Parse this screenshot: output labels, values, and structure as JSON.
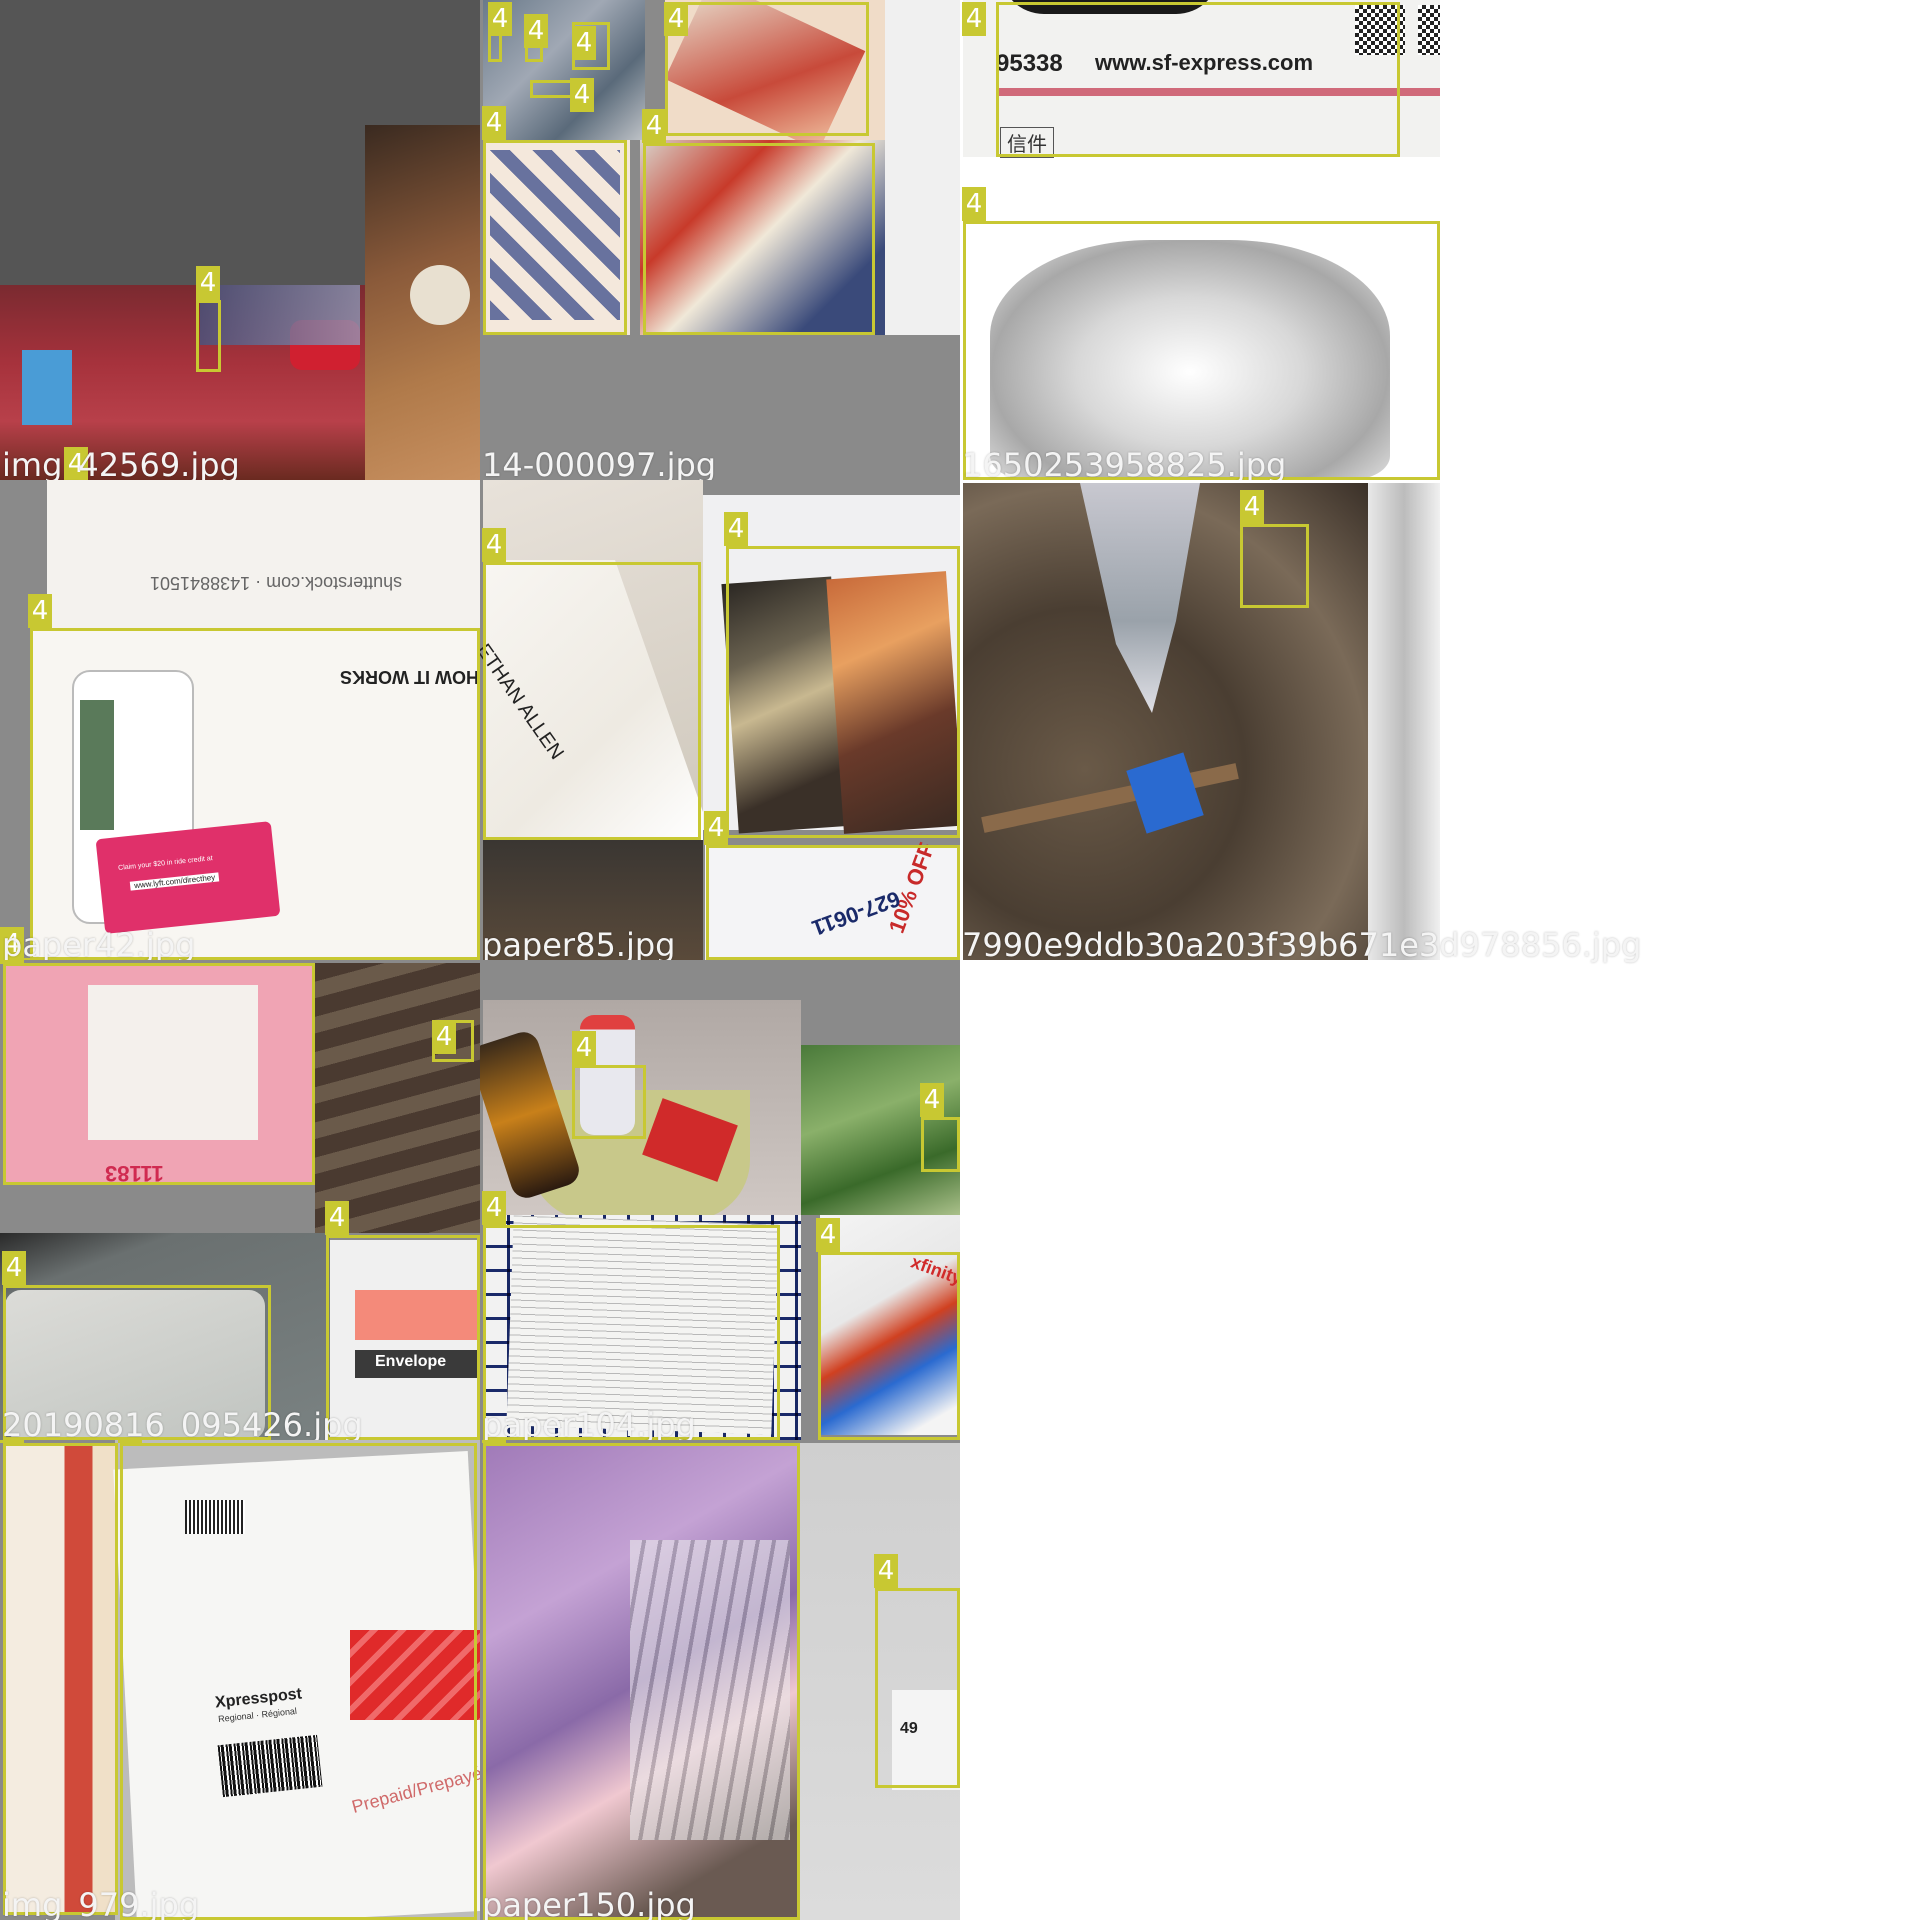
{
  "colors": {
    "box": "#c8c832",
    "label_text": "#ffffff",
    "filename_text": "#f4f4f4",
    "gray_background": "#8a8a8a",
    "dark_background": "#555555"
  },
  "tiles": [
    {
      "filename": "img_42569.jpg",
      "box_labels": [
        "4",
        "4"
      ]
    },
    {
      "filename": "14-000097.jpg",
      "box_labels": [
        "4",
        "4",
        "4",
        "4",
        "4",
        "4",
        "4",
        "4"
      ]
    },
    {
      "filename": "1650253958825.jpg",
      "box_labels": [
        "4",
        "4"
      ],
      "texts": {
        "phone": "95338",
        "url": "www.sf-express.com",
        "stamp": "信件"
      }
    },
    {
      "filename": "paper42.jpg",
      "box_labels": [
        "4",
        "4"
      ],
      "texts": {
        "heading": "HOW IT WORKS",
        "watermark": "shutterstock.com · 1438841501",
        "promo": "Claim your $20 in ride credit at",
        "link": "www.lyft.com/directhey"
      }
    },
    {
      "filename": "paper85.jpg",
      "box_labels": [
        "4",
        "4",
        "4"
      ],
      "texts": {
        "brand": "ETHAN ALLEN",
        "phone": "627-0611",
        "discount": "10% OFF"
      }
    },
    {
      "filename": "7990e9ddb30a203f39b671e3d978856.jpg",
      "box_labels": [
        "4"
      ]
    },
    {
      "filename": "20190816_095426.jpg",
      "box_labels": [
        "4",
        "4",
        "4",
        "4"
      ],
      "texts": {
        "envelope": "Envelope",
        "code": "11183"
      }
    },
    {
      "filename": "paper104.jpg",
      "box_labels": [
        "4",
        "4",
        "4",
        "4"
      ],
      "texts": {
        "brand": "xfinity"
      }
    },
    {
      "filename": "img_979.jpg",
      "box_labels": [
        "4",
        "4"
      ],
      "texts": {
        "brand": "Xpresspost",
        "sub": "Regional · Régional",
        "prepaid": "Prepaid/Prepayé"
      }
    },
    {
      "filename": "paper150.jpg",
      "box_labels": [
        "4",
        "4"
      ],
      "texts": {
        "price": "49"
      }
    }
  ]
}
